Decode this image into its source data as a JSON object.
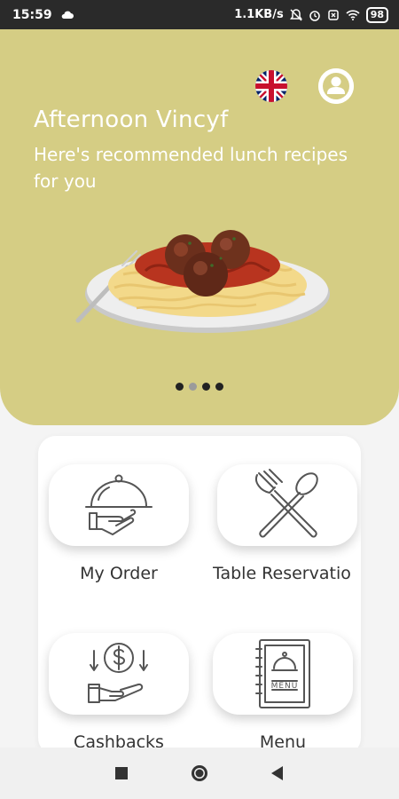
{
  "status_bar": {
    "time": "15:59",
    "network_speed": "1.1KB/s",
    "battery": "98"
  },
  "header": {
    "greeting": "Afternoon Vincyf",
    "subtitle": "Here's recommended lunch recipes for you",
    "carousel_total": 4,
    "carousel_active_index": 1,
    "background_color": "#d5cd84"
  },
  "menu": [
    {
      "label": "My Order",
      "icon": "cloche-serving-icon"
    },
    {
      "label": "Table Reservatio",
      "icon": "fork-spoon-icon"
    },
    {
      "label": "Cashbacks",
      "icon": "cashback-icon"
    },
    {
      "label": "Menu",
      "icon": "menu-book-icon"
    }
  ]
}
